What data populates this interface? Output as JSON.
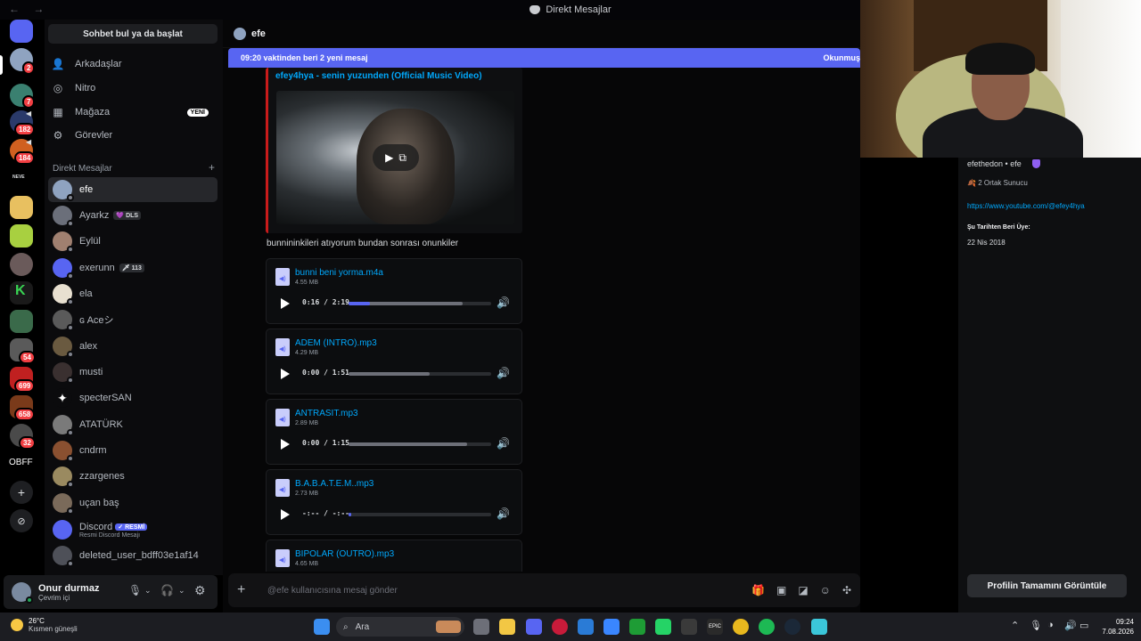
{
  "window": {
    "title": "Direkt Mesajlar",
    "nav_arrows": "← →"
  },
  "rail": {
    "badges": [
      "2",
      "7",
      "182",
      "184",
      "699",
      "658",
      "32",
      "54"
    ],
    "text_server": "OBFF",
    "neve": "NEVE"
  },
  "sidebar": {
    "search_label": "Sohbet bul ya da başlat",
    "nav": [
      {
        "label": "Arkadaşlar",
        "icon": "friends-icon"
      },
      {
        "label": "Nitro",
        "icon": "nitro-icon"
      },
      {
        "label": "Mağaza",
        "icon": "shop-icon",
        "badge": "YENİ"
      },
      {
        "label": "Görevler",
        "icon": "quests-icon"
      }
    ],
    "dm_header": "Direkt Mesajlar",
    "dm_add": "+",
    "dms": [
      {
        "name": "efe",
        "color": "#8fa3c0"
      },
      {
        "name": "Ayarkz",
        "color": "#6b6f7a",
        "tag": "DLS",
        "tag_icon": "💜"
      },
      {
        "name": "Eylül",
        "color": "#a08070"
      },
      {
        "name": "exerunn",
        "color": "#5865f2",
        "tag": "113",
        "tag_icon": "🗡"
      },
      {
        "name": "ela",
        "color": "#e8e0d0"
      },
      {
        "name": "ɢ Aceシ",
        "color": "#5a5a5a"
      },
      {
        "name": "alex",
        "color": "#6a5a40"
      },
      {
        "name": "musti",
        "color": "#3a3030"
      },
      {
        "name": "specterSAN",
        "color": "#0b0b0d"
      },
      {
        "name": "ATATÜRK",
        "color": "#7a7a7a"
      },
      {
        "name": "cndrm",
        "color": "#8a5030"
      },
      {
        "name": "zzargenes",
        "color": "#9a8a60"
      },
      {
        "name": "uçan baş",
        "color": "#7a6a5a"
      },
      {
        "name": "Discord",
        "color": "#5865f2",
        "official": "✓ RESMİ",
        "sub": "Resmi Discord Mesajı"
      },
      {
        "name": "deleted_user_bdff03e1af14",
        "color": "#4e5058"
      }
    ]
  },
  "user": {
    "name": "Onur durmaz",
    "status": "Çevrim içi"
  },
  "chat": {
    "title": "efe",
    "new_messages": "09:20 vaktinden beri 2 yeni mesaj",
    "mark_read": "Okunmuş",
    "embed_title": "efey4hya - senin yuzunden (Official Music Video)",
    "message": "bunnininkileri atıyorum bundan sonrası onunkiler",
    "attachments": [
      {
        "name": "bunni beni yorma.m4a",
        "size": "4.55 MB",
        "time": "0:16 / 2:19",
        "progress": 0.15,
        "buffered": 0.8
      },
      {
        "name": "ADEM (INTRO).mp3",
        "size": "4.29 MB",
        "time": "0:00 / 1:51",
        "progress": 0,
        "buffered": 0.57
      },
      {
        "name": "ANTRASIT.mp3",
        "size": "2.89 MB",
        "time": "0:00 / 1:15",
        "progress": 0,
        "buffered": 0.83
      },
      {
        "name": "B.A.B.A.T.E.M..mp3",
        "size": "2.73 MB",
        "time": "-:-- / -:--",
        "progress": 0.02,
        "buffered": 0
      },
      {
        "name": "BIPOLAR (OUTRO).mp3",
        "size": "4.65 MB",
        "time": "",
        "progress": 0,
        "buffered": 0
      }
    ],
    "input_placeholder": "@efe kullanıcısına mesaj gönder"
  },
  "profile": {
    "handle": "efethedon • efe",
    "mutual": "2 Ortak Sunucu",
    "link": "https://www.youtube.com/@efey4hya",
    "member_since_label": "Şu Tarihten Beri Üye:",
    "member_since": "22 Nis 2018",
    "full_profile_button": "Profilin Tamamını Görüntüle"
  },
  "taskbar": {
    "temp": "26°C",
    "weather": "Kısmen güneşli",
    "search": "Ara",
    "time": "09:24",
    "date": "7.08.2026"
  }
}
